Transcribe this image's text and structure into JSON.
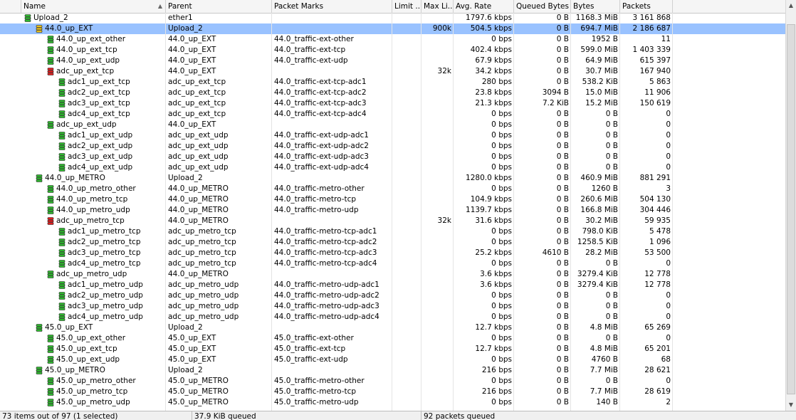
{
  "columns": [
    {
      "key": "name",
      "label": "Name"
    },
    {
      "key": "parent",
      "label": "Parent"
    },
    {
      "key": "marks",
      "label": "Packet Marks"
    },
    {
      "key": "limitat",
      "label": "Limit ..."
    },
    {
      "key": "maxlimit",
      "label": "Max Li..."
    },
    {
      "key": "rate",
      "label": "Avg. Rate"
    },
    {
      "key": "qbytes",
      "label": "Queued Bytes"
    },
    {
      "key": "bytes",
      "label": "Bytes"
    },
    {
      "key": "packets",
      "label": "Packets"
    }
  ],
  "colors": {
    "selected_row": "#99c2ff",
    "icon_green": "#2fb82f",
    "icon_red": "#e02020",
    "icon_yellow": "#e8c020"
  },
  "rows": [
    {
      "level": 0,
      "icon": "green",
      "name": "Upload_2",
      "parent": "ether1",
      "marks": "",
      "limitat": "",
      "maxlimit": "",
      "rate": "1797.6 kbps",
      "qbytes": "0 B",
      "bytes": "1168.3 MiB",
      "packets": "3 161 868"
    },
    {
      "level": 1,
      "icon": "yellow",
      "selected": true,
      "name": "44.0_up_EXT",
      "parent": "Upload_2",
      "marks": "",
      "limitat": "",
      "maxlimit": "900k",
      "rate": "504.5 kbps",
      "qbytes": "0 B",
      "bytes": "694.7 MiB",
      "packets": "2 186 687"
    },
    {
      "level": 2,
      "icon": "green",
      "name": "44.0_up_ext_other",
      "parent": "44.0_up_EXT",
      "marks": "44.0_traffic-ext-other",
      "limitat": "",
      "maxlimit": "",
      "rate": "0 bps",
      "qbytes": "0 B",
      "bytes": "1952 B",
      "packets": "11"
    },
    {
      "level": 2,
      "icon": "green",
      "name": "44.0_up_ext_tcp",
      "parent": "44.0_up_EXT",
      "marks": "44.0_traffic-ext-tcp",
      "limitat": "",
      "maxlimit": "",
      "rate": "402.4 kbps",
      "qbytes": "0 B",
      "bytes": "599.0 MiB",
      "packets": "1 403 339"
    },
    {
      "level": 2,
      "icon": "green",
      "name": "44.0_up_ext_udp",
      "parent": "44.0_up_EXT",
      "marks": "44.0_traffic-ext-udp",
      "limitat": "",
      "maxlimit": "",
      "rate": "67.9 kbps",
      "qbytes": "0 B",
      "bytes": "64.9 MiB",
      "packets": "615 397"
    },
    {
      "level": 2,
      "icon": "red",
      "name": "adc_up_ext_tcp",
      "parent": "44.0_up_EXT",
      "marks": "",
      "limitat": "",
      "maxlimit": "32k",
      "rate": "34.2 kbps",
      "qbytes": "0 B",
      "bytes": "30.7 MiB",
      "packets": "167 940"
    },
    {
      "level": 3,
      "icon": "green",
      "name": "adc1_up_ext_tcp",
      "parent": "adc_up_ext_tcp",
      "marks": "44.0_traffic-ext-tcp-adc1",
      "limitat": "",
      "maxlimit": "",
      "rate": "280 bps",
      "qbytes": "0 B",
      "bytes": "538.2 KiB",
      "packets": "5 863"
    },
    {
      "level": 3,
      "icon": "green",
      "name": "adc2_up_ext_tcp",
      "parent": "adc_up_ext_tcp",
      "marks": "44.0_traffic-ext-tcp-adc2",
      "limitat": "",
      "maxlimit": "",
      "rate": "23.8 kbps",
      "qbytes": "3094 B",
      "bytes": "15.0 MiB",
      "packets": "11 906"
    },
    {
      "level": 3,
      "icon": "green",
      "name": "adc3_up_ext_tcp",
      "parent": "adc_up_ext_tcp",
      "marks": "44.0_traffic-ext-tcp-adc3",
      "limitat": "",
      "maxlimit": "",
      "rate": "21.3 kbps",
      "qbytes": "7.2 KiB",
      "bytes": "15.2 MiB",
      "packets": "150 619"
    },
    {
      "level": 3,
      "icon": "green",
      "name": "adc4_up_ext_tcp",
      "parent": "adc_up_ext_tcp",
      "marks": "44.0_traffic-ext-tcp-adc4",
      "limitat": "",
      "maxlimit": "",
      "rate": "0 bps",
      "qbytes": "0 B",
      "bytes": "0 B",
      "packets": "0"
    },
    {
      "level": 2,
      "icon": "green",
      "name": "adc_up_ext_udp",
      "parent": "44.0_up_EXT",
      "marks": "",
      "limitat": "",
      "maxlimit": "",
      "rate": "0 bps",
      "qbytes": "0 B",
      "bytes": "0 B",
      "packets": "0"
    },
    {
      "level": 3,
      "icon": "green",
      "name": "adc1_up_ext_udp",
      "parent": "adc_up_ext_udp",
      "marks": "44.0_traffic-ext-udp-adc1",
      "limitat": "",
      "maxlimit": "",
      "rate": "0 bps",
      "qbytes": "0 B",
      "bytes": "0 B",
      "packets": "0"
    },
    {
      "level": 3,
      "icon": "green",
      "name": "adc2_up_ext_udp",
      "parent": "adc_up_ext_udp",
      "marks": "44.0_traffic-ext-udp-adc2",
      "limitat": "",
      "maxlimit": "",
      "rate": "0 bps",
      "qbytes": "0 B",
      "bytes": "0 B",
      "packets": "0"
    },
    {
      "level": 3,
      "icon": "green",
      "name": "adc3_up_ext_udp",
      "parent": "adc_up_ext_udp",
      "marks": "44.0_traffic-ext-udp-adc3",
      "limitat": "",
      "maxlimit": "",
      "rate": "0 bps",
      "qbytes": "0 B",
      "bytes": "0 B",
      "packets": "0"
    },
    {
      "level": 3,
      "icon": "green",
      "name": "adc4_up_ext_udp",
      "parent": "adc_up_ext_udp",
      "marks": "44.0_traffic-ext-udp-adc4",
      "limitat": "",
      "maxlimit": "",
      "rate": "0 bps",
      "qbytes": "0 B",
      "bytes": "0 B",
      "packets": "0"
    },
    {
      "level": 1,
      "icon": "green",
      "name": "44.0_up_METRO",
      "parent": "Upload_2",
      "marks": "",
      "limitat": "",
      "maxlimit": "",
      "rate": "1280.0 kbps",
      "qbytes": "0 B",
      "bytes": "460.9 MiB",
      "packets": "881 291"
    },
    {
      "level": 2,
      "icon": "green",
      "name": "44.0_up_metro_other",
      "parent": "44.0_up_METRO",
      "marks": "44.0_traffic-metro-other",
      "limitat": "",
      "maxlimit": "",
      "rate": "0 bps",
      "qbytes": "0 B",
      "bytes": "1260 B",
      "packets": "3"
    },
    {
      "level": 2,
      "icon": "green",
      "name": "44.0_up_metro_tcp",
      "parent": "44.0_up_METRO",
      "marks": "44.0_traffic-metro-tcp",
      "limitat": "",
      "maxlimit": "",
      "rate": "104.9 kbps",
      "qbytes": "0 B",
      "bytes": "260.6 MiB",
      "packets": "504 130"
    },
    {
      "level": 2,
      "icon": "green",
      "name": "44.0_up_metro_udp",
      "parent": "44.0_up_METRO",
      "marks": "44.0_traffic-metro-udp",
      "limitat": "",
      "maxlimit": "",
      "rate": "1139.7 kbps",
      "qbytes": "0 B",
      "bytes": "166.8 MiB",
      "packets": "304 446"
    },
    {
      "level": 2,
      "icon": "red",
      "name": "adc_up_metro_tcp",
      "parent": "44.0_up_METRO",
      "marks": "",
      "limitat": "",
      "maxlimit": "32k",
      "rate": "31.6 kbps",
      "qbytes": "0 B",
      "bytes": "30.2 MiB",
      "packets": "59 935"
    },
    {
      "level": 3,
      "icon": "green",
      "name": "adc1_up_metro_tcp",
      "parent": "adc_up_metro_tcp",
      "marks": "44.0_traffic-metro-tcp-adc1",
      "limitat": "",
      "maxlimit": "",
      "rate": "0 bps",
      "qbytes": "0 B",
      "bytes": "798.0 KiB",
      "packets": "5 478"
    },
    {
      "level": 3,
      "icon": "green",
      "name": "adc2_up_metro_tcp",
      "parent": "adc_up_metro_tcp",
      "marks": "44.0_traffic-metro-tcp-adc2",
      "limitat": "",
      "maxlimit": "",
      "rate": "0 bps",
      "qbytes": "0 B",
      "bytes": "1258.5 KiB",
      "packets": "1 096"
    },
    {
      "level": 3,
      "icon": "green",
      "name": "adc3_up_metro_tcp",
      "parent": "adc_up_metro_tcp",
      "marks": "44.0_traffic-metro-tcp-adc3",
      "limitat": "",
      "maxlimit": "",
      "rate": "25.2 kbps",
      "qbytes": "4610 B",
      "bytes": "28.2 MiB",
      "packets": "53 500"
    },
    {
      "level": 3,
      "icon": "green",
      "name": "adc4_up_metro_tcp",
      "parent": "adc_up_metro_tcp",
      "marks": "44.0_traffic-metro-tcp-adc4",
      "limitat": "",
      "maxlimit": "",
      "rate": "0 bps",
      "qbytes": "0 B",
      "bytes": "0 B",
      "packets": "0"
    },
    {
      "level": 2,
      "icon": "green",
      "name": "adc_up_metro_udp",
      "parent": "44.0_up_METRO",
      "marks": "",
      "limitat": "",
      "maxlimit": "",
      "rate": "3.6 kbps",
      "qbytes": "0 B",
      "bytes": "3279.4 KiB",
      "packets": "12 778"
    },
    {
      "level": 3,
      "icon": "green",
      "name": "adc1_up_metro_udp",
      "parent": "adc_up_metro_udp",
      "marks": "44.0_traffic-metro-udp-adc1",
      "limitat": "",
      "maxlimit": "",
      "rate": "3.6 kbps",
      "qbytes": "0 B",
      "bytes": "3279.4 KiB",
      "packets": "12 778"
    },
    {
      "level": 3,
      "icon": "green",
      "name": "adc2_up_metro_udp",
      "parent": "adc_up_metro_udp",
      "marks": "44.0_traffic-metro-udp-adc2",
      "limitat": "",
      "maxlimit": "",
      "rate": "0 bps",
      "qbytes": "0 B",
      "bytes": "0 B",
      "packets": "0"
    },
    {
      "level": 3,
      "icon": "green",
      "name": "adc3_up_metro_udp",
      "parent": "adc_up_metro_udp",
      "marks": "44.0_traffic-metro-udp-adc3",
      "limitat": "",
      "maxlimit": "",
      "rate": "0 bps",
      "qbytes": "0 B",
      "bytes": "0 B",
      "packets": "0"
    },
    {
      "level": 3,
      "icon": "green",
      "name": "adc4_up_metro_udp",
      "parent": "adc_up_metro_udp",
      "marks": "44.0_traffic-metro-udp-adc4",
      "limitat": "",
      "maxlimit": "",
      "rate": "0 bps",
      "qbytes": "0 B",
      "bytes": "0 B",
      "packets": "0"
    },
    {
      "level": 1,
      "icon": "green",
      "name": "45.0_up_EXT",
      "parent": "Upload_2",
      "marks": "",
      "limitat": "",
      "maxlimit": "",
      "rate": "12.7 kbps",
      "qbytes": "0 B",
      "bytes": "4.8 MiB",
      "packets": "65 269"
    },
    {
      "level": 2,
      "icon": "green",
      "name": "45.0_up_ext_other",
      "parent": "45.0_up_EXT",
      "marks": "45.0_traffic-ext-other",
      "limitat": "",
      "maxlimit": "",
      "rate": "0 bps",
      "qbytes": "0 B",
      "bytes": "0 B",
      "packets": "0"
    },
    {
      "level": 2,
      "icon": "green",
      "name": "45.0_up_ext_tcp",
      "parent": "45.0_up_EXT",
      "marks": "45.0_traffic-ext-tcp",
      "limitat": "",
      "maxlimit": "",
      "rate": "12.7 kbps",
      "qbytes": "0 B",
      "bytes": "4.8 MiB",
      "packets": "65 201"
    },
    {
      "level": 2,
      "icon": "green",
      "name": "45.0_up_ext_udp",
      "parent": "45.0_up_EXT",
      "marks": "45.0_traffic-ext-udp",
      "limitat": "",
      "maxlimit": "",
      "rate": "0 bps",
      "qbytes": "0 B",
      "bytes": "4760 B",
      "packets": "68"
    },
    {
      "level": 1,
      "icon": "green",
      "name": "45.0_up_METRO",
      "parent": "Upload_2",
      "marks": "",
      "limitat": "",
      "maxlimit": "",
      "rate": "216 bps",
      "qbytes": "0 B",
      "bytes": "7.7 MiB",
      "packets": "28 621"
    },
    {
      "level": 2,
      "icon": "green",
      "name": "45.0_up_metro_other",
      "parent": "45.0_up_METRO",
      "marks": "45.0_traffic-metro-other",
      "limitat": "",
      "maxlimit": "",
      "rate": "0 bps",
      "qbytes": "0 B",
      "bytes": "0 B",
      "packets": "0"
    },
    {
      "level": 2,
      "icon": "green",
      "name": "45.0_up_metro_tcp",
      "parent": "45.0_up_METRO",
      "marks": "45.0_traffic-metro-tcp",
      "limitat": "",
      "maxlimit": "",
      "rate": "216 bps",
      "qbytes": "0 B",
      "bytes": "7.7 MiB",
      "packets": "28 619"
    },
    {
      "level": 2,
      "icon": "green",
      "name": "45.0_up_metro_udp",
      "parent": "45.0_up_METRO",
      "marks": "45.0_traffic-metro-udp",
      "limitat": "",
      "maxlimit": "",
      "rate": "0 bps",
      "qbytes": "0 B",
      "bytes": "140 B",
      "packets": "2"
    }
  ],
  "status": {
    "items": "73 items out of 97 (1 selected)",
    "queued": "37.9 KiB queued",
    "packets": "92 packets queued"
  }
}
